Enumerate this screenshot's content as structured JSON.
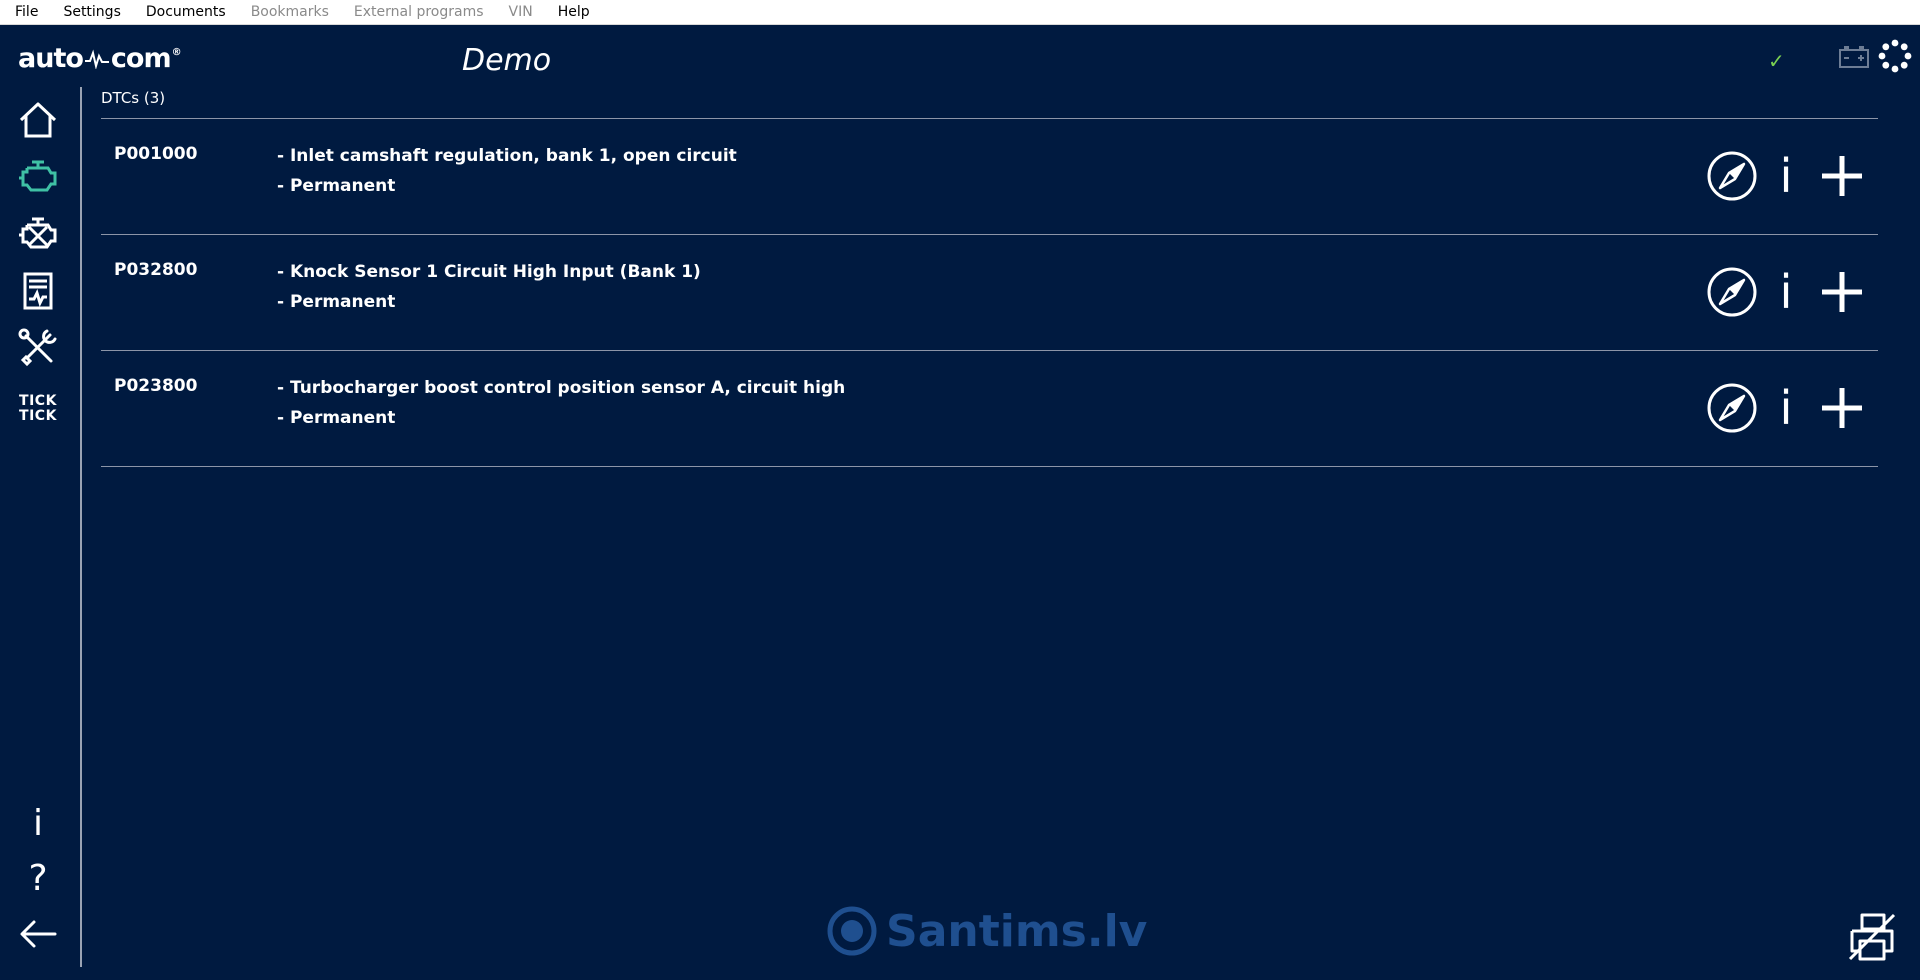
{
  "menu": {
    "items": [
      {
        "label": "File",
        "enabled": true
      },
      {
        "label": "Settings",
        "enabled": true
      },
      {
        "label": "Documents",
        "enabled": true
      },
      {
        "label": "Bookmarks",
        "enabled": false
      },
      {
        "label": "External programs",
        "enabled": false
      },
      {
        "label": "VIN",
        "enabled": false
      },
      {
        "label": "Help",
        "enabled": true
      }
    ]
  },
  "header": {
    "logo_left": "auto",
    "logo_right": "com",
    "logo_mark": "®",
    "title": "Demo",
    "status_check": "✓"
  },
  "sidebar": {
    "items": [
      {
        "name": "home-icon"
      },
      {
        "name": "engine-icon",
        "active": true
      },
      {
        "name": "engine-crossed-icon"
      },
      {
        "name": "report-icon"
      },
      {
        "name": "tools-icon"
      },
      {
        "name": "tick-tick-icon",
        "label_line1": "TICK",
        "label_line2": "TICK"
      }
    ],
    "bottom": {
      "info": "i",
      "help": "?",
      "back": "←"
    }
  },
  "dtc": {
    "header": "DTCs (3)",
    "rows": [
      {
        "code": "P001000",
        "description": "- Inlet camshaft regulation, bank 1, open circuit",
        "status": "- Permanent"
      },
      {
        "code": "P032800",
        "description": "- Knock Sensor 1 Circuit High Input (Bank 1)",
        "status": "- Permanent"
      },
      {
        "code": "P023800",
        "description": "- Turbocharger boost control position sensor A, circuit high",
        "status": "- Permanent"
      }
    ],
    "action_info_glyph": "i"
  },
  "watermark": {
    "text": "Santims.lv"
  },
  "colors": {
    "background": "#001a40",
    "active_icon": "#3fc1a5",
    "check": "#7ad151",
    "divider": "#8c95a8"
  }
}
